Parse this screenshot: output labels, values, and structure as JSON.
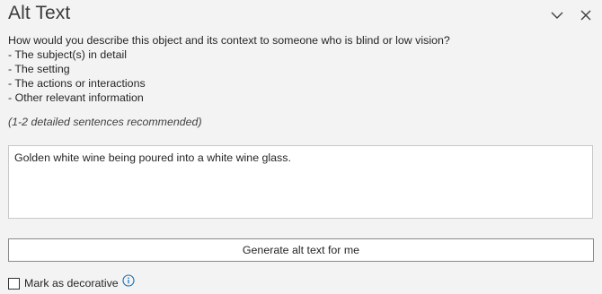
{
  "pane": {
    "title": "Alt Text",
    "collapse_icon": "chevron-down-icon",
    "close_icon": "close-icon"
  },
  "prompt": {
    "question": "How would you describe this object and its context to someone who is blind or low vision?",
    "bullets": [
      "- The subject(s) in detail",
      "- The setting",
      "- The actions or interactions",
      "- Other relevant information"
    ],
    "hint": "(1-2 detailed sentences recommended)"
  },
  "alt_text": {
    "value": "Golden white wine being poured into a white wine glass."
  },
  "generate_button": {
    "label": "Generate alt text for me"
  },
  "decorative": {
    "label": "Mark as decorative",
    "checked": false,
    "info_icon": "info-icon"
  },
  "colors": {
    "background": "#f3f3f3",
    "accent": "#0f6cbd",
    "border": "#c8c8c8"
  }
}
